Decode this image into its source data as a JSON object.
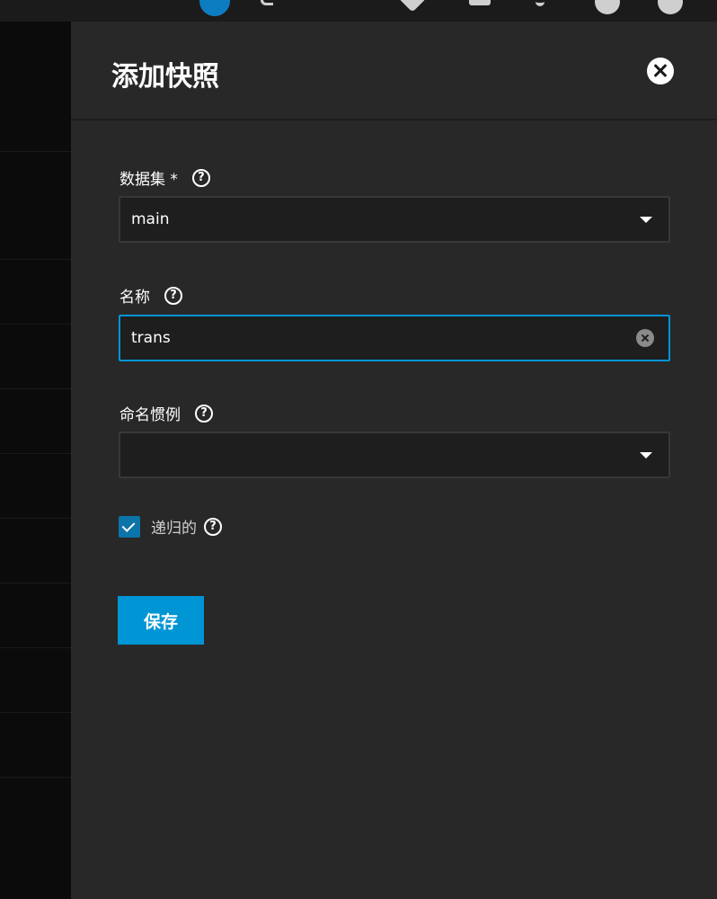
{
  "dialog": {
    "title": "添加快照"
  },
  "fields": {
    "dataset": {
      "label": "数据集 *",
      "value": "main"
    },
    "name": {
      "label": "名称",
      "value": "trans"
    },
    "naming_schema": {
      "label": "命名惯例",
      "value": ""
    }
  },
  "recursive": {
    "label": "递归的",
    "checked": true
  },
  "actions": {
    "save_label": "保存"
  },
  "icons": {
    "help": "?"
  },
  "colors": {
    "accent": "#0095d5",
    "panel_bg": "#282828",
    "input_bg": "#1e1e1e"
  }
}
